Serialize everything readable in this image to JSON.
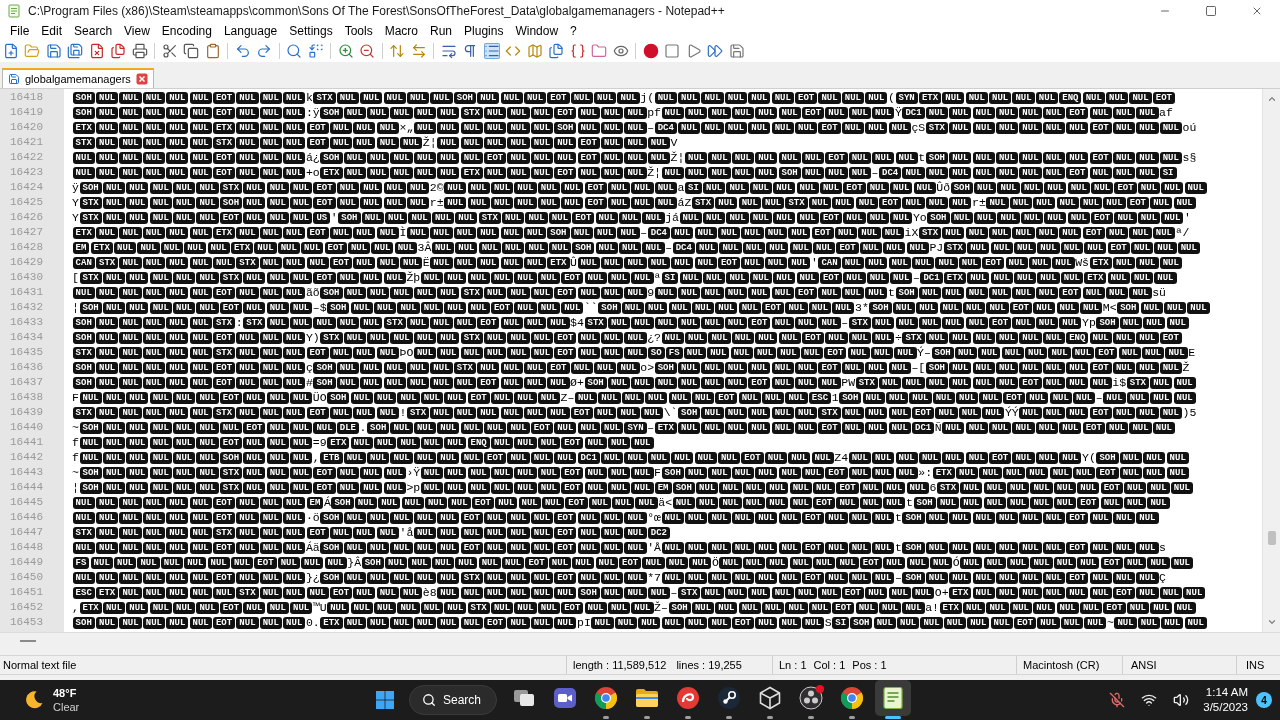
{
  "window": {
    "title": "C:\\Program Files (x86)\\Steam\\steamapps\\common\\Sons Of The Forest\\SonsOfTheForest_Data\\globalgamemanagers - Notepad++"
  },
  "menu": [
    "File",
    "Edit",
    "Search",
    "View",
    "Encoding",
    "Language",
    "Settings",
    "Tools",
    "Macro",
    "Run",
    "Plugins",
    "Window",
    "?"
  ],
  "toolbar": [
    [
      {
        "kind": "new",
        "pressed": false
      },
      {
        "kind": "open",
        "pressed": false
      },
      {
        "kind": "save",
        "pressed": false
      },
      {
        "kind": "save-all",
        "pressed": false
      },
      {
        "kind": "close",
        "pressed": false
      },
      {
        "kind": "close-all",
        "pressed": false
      },
      {
        "kind": "print",
        "pressed": false
      }
    ],
    [
      {
        "kind": "cut",
        "pressed": false
      },
      {
        "kind": "copy",
        "pressed": false
      },
      {
        "kind": "paste",
        "pressed": false
      }
    ],
    [
      {
        "kind": "undo",
        "pressed": false
      },
      {
        "kind": "redo",
        "pressed": false
      }
    ],
    [
      {
        "kind": "find",
        "pressed": false
      },
      {
        "kind": "replace",
        "pressed": false
      }
    ],
    [
      {
        "kind": "zoom-in",
        "pressed": false
      },
      {
        "kind": "zoom-out",
        "pressed": false
      }
    ],
    [
      {
        "kind": "sync-vertical",
        "pressed": false
      },
      {
        "kind": "sync-horizontal",
        "pressed": false
      }
    ],
    [
      {
        "kind": "wrap",
        "pressed": false
      },
      {
        "kind": "all-chars",
        "pressed": false
      },
      {
        "kind": "indent-guide",
        "pressed": true
      },
      {
        "kind": "user-language",
        "pressed": false
      },
      {
        "kind": "doc-map",
        "pressed": false
      },
      {
        "kind": "doc-list",
        "pressed": false
      },
      {
        "kind": "function-list",
        "pressed": false
      },
      {
        "kind": "folder-workspace",
        "pressed": false
      },
      {
        "kind": "monitor",
        "pressed": false
      }
    ],
    [
      {
        "kind": "record",
        "pressed": false
      },
      {
        "kind": "stop",
        "pressed": false
      },
      {
        "kind": "play",
        "pressed": false
      },
      {
        "kind": "play-multiple",
        "pressed": false
      },
      {
        "kind": "save-macro",
        "pressed": false
      }
    ]
  ],
  "tabs": [
    {
      "label": "globalgamemanagers",
      "selected": true
    }
  ],
  "editor": {
    "lines": [
      {
        "number": "16418",
        "tokens": [
          "SOH",
          "NUL",
          "NUL",
          "NUL",
          "NUL",
          "NUL",
          "EOT",
          "NUL",
          "NUL",
          "NUL",
          "k",
          "STX",
          "NUL",
          "NUL",
          "NUL",
          "NUL",
          "NUL",
          "SOH",
          "NUL",
          "NUL",
          "NUL",
          "EOT",
          "NUL",
          "NUL",
          "NUL",
          "j",
          "(",
          "NUL",
          "NUL",
          "NUL",
          "NUL",
          "NUL",
          "NUL",
          "EOT",
          "NUL",
          "NUL",
          "NUL",
          "(",
          "SYN",
          "ETX",
          "NUL",
          "NUL",
          "NUL",
          "NUL",
          "NUL",
          "ENQ",
          "NUL",
          "NUL",
          "NUL",
          "EOT"
        ]
      },
      {
        "number": "16419",
        "tokens": [
          "SOH",
          "NUL",
          "NUL",
          "NUL",
          "NUL",
          "NUL",
          "EOT",
          "NUL",
          "NUL",
          "NUL",
          ":",
          "ÿ",
          "SOH",
          "NUL",
          "NUL",
          "NUL",
          "NUL",
          "NUL",
          "STX",
          "NUL",
          "NUL",
          "NUL",
          "EOT",
          "NUL",
          "NUL",
          "NUL",
          "p",
          "f",
          "NUL",
          "NUL",
          "NUL",
          "NUL",
          "NUL",
          "NUL",
          "EOT",
          "NUL",
          "NUL",
          "NUL",
          "Ÿ",
          "DC1",
          "NUL",
          "NUL",
          "NUL",
          "NUL",
          "NUL",
          "NUL",
          "EOT",
          "NUL",
          "NUL",
          "NUL",
          "a",
          "f"
        ]
      },
      {
        "number": "16420",
        "tokens": [
          "ETX",
          "NUL",
          "NUL",
          "NUL",
          "NUL",
          "NUL",
          "ETX",
          "NUL",
          "NUL",
          "NUL",
          "EOT",
          "NUL",
          "NUL",
          "NUL",
          "×",
          "„",
          "NUL",
          "NUL",
          "NUL",
          "NUL",
          "NUL",
          "NUL",
          "SOH",
          "NUL",
          "NUL",
          "NUL",
          "–",
          "DC4",
          "NUL",
          "NUL",
          "NUL",
          "NUL",
          "NUL",
          "NUL",
          "EOT",
          "NUL",
          "NUL",
          "NUL",
          "ç",
          "S",
          "STX",
          "NUL",
          "NUL",
          "NUL",
          "NUL",
          "NUL",
          "NUL",
          "EOT",
          "NUL",
          "NUL",
          "NUL",
          "o",
          "ú"
        ]
      },
      {
        "number": "16421",
        "tokens": [
          "STX",
          "NUL",
          "NUL",
          "NUL",
          "NUL",
          "NUL",
          "STX",
          "NUL",
          "NUL",
          "NUL",
          "EOT",
          "NUL",
          "NUL",
          "NUL",
          "NUL",
          "Ž",
          "¦",
          "NUL",
          "NUL",
          "NUL",
          "NUL",
          "NUL",
          "NUL",
          "EOT",
          "NUL",
          "NUL",
          "NUL",
          "V"
        ]
      },
      {
        "number": "16422",
        "tokens": [
          "NUL",
          "NUL",
          "NUL",
          "NUL",
          "NUL",
          "NUL",
          "EOT",
          "NUL",
          "NUL",
          "NUL",
          "á",
          "¿",
          "SOH",
          "NUL",
          "NUL",
          "NUL",
          "NUL",
          "NUL",
          "NUL",
          "EOT",
          "NUL",
          "NUL",
          "NUL",
          "EOT",
          "NUL",
          "NUL",
          "NUL",
          "Ž",
          "¦",
          "NUL",
          "NUL",
          "NUL",
          "NUL",
          "NUL",
          "NUL",
          "EOT",
          "NUL",
          "NUL",
          "NUL",
          "t",
          "SOH",
          "NUL",
          "NUL",
          "NUL",
          "NUL",
          "NUL",
          "NUL",
          "EOT",
          "NUL",
          "NUL",
          "NUL",
          "s",
          "§"
        ]
      },
      {
        "number": "16423",
        "tokens": [
          "NUL",
          "NUL",
          "NUL",
          "NUL",
          "NUL",
          "NUL",
          "EOT",
          "NUL",
          "NUL",
          "NUL",
          "+",
          "o",
          "ETX",
          "NUL",
          "NUL",
          "NUL",
          "NUL",
          "NUL",
          "ETX",
          "NUL",
          "NUL",
          "NUL",
          "EOT",
          "NUL",
          "NUL",
          "NUL",
          "Ž",
          "¦",
          "NUL",
          "NUL",
          "NUL",
          "NUL",
          "NUL",
          "SOH",
          "NUL",
          "NUL",
          "NUL",
          "–",
          "DC4",
          "NUL",
          "NUL",
          "NUL",
          "NUL",
          "NUL",
          "NUL",
          "NUL",
          "EOT",
          "NUL",
          "NUL",
          "NUL",
          "SI"
        ]
      },
      {
        "number": "16424",
        "tokens": [
          "ÿ",
          "SOH",
          "NUL",
          "NUL",
          "NUL",
          "NUL",
          "NUL",
          "STX",
          "NUL",
          "NUL",
          "NUL",
          "EOT",
          "NUL",
          "NUL",
          "NUL",
          "NUL",
          "2",
          "©",
          "NUL",
          "NUL",
          "NUL",
          "NUL",
          "NUL",
          "NUL",
          "EOT",
          "NUL",
          "NUL",
          "NUL",
          "a",
          "SI",
          "NUL",
          "NUL",
          "NUL",
          "NUL",
          "NUL",
          "NUL",
          "EOT",
          "NUL",
          "NUL",
          "NUL",
          "Û",
          "ð",
          "SOH",
          "NUL",
          "NUL",
          "NUL",
          "NUL",
          "NUL",
          "NUL",
          "EOT",
          "NUL",
          "NUL",
          "NUL"
        ]
      },
      {
        "number": "16425",
        "tokens": [
          "Y",
          "STX",
          "NUL",
          "NUL",
          "NUL",
          "NUL",
          "NUL",
          "SOH",
          "NUL",
          "NUL",
          "NUL",
          "EOT",
          "NUL",
          "NUL",
          "NUL",
          "NUL",
          "r",
          "±",
          "NUL",
          "NUL",
          "NUL",
          "NUL",
          "NUL",
          "NUL",
          "EOT",
          "NUL",
          "NUL",
          "NUL",
          "á",
          "Z",
          "STX",
          "NUL",
          "NUL",
          "NUL",
          "STX",
          "NUL",
          "NUL",
          "NUL",
          "EOT",
          "NUL",
          "NUL",
          "NUL",
          "r",
          "±",
          "NUL",
          "NUL",
          "NUL",
          "NUL",
          "NUL",
          "NUL",
          "EOT",
          "NUL",
          "NUL"
        ]
      },
      {
        "number": "16426",
        "tokens": [
          "Y",
          "STX",
          "NUL",
          "NUL",
          "NUL",
          "NUL",
          "NUL",
          "EOT",
          "NUL",
          "NUL",
          "NUL",
          "US",
          "'",
          "SOH",
          "NUL",
          "NUL",
          "NUL",
          "NUL",
          "NUL",
          "STX",
          "NUL",
          "NUL",
          "NUL",
          "EOT",
          "NUL",
          "NUL",
          "NUL",
          "j",
          "á",
          "NUL",
          "NUL",
          "NUL",
          "NUL",
          "NUL",
          "NUL",
          "EOT",
          "NUL",
          "NUL",
          "NUL",
          "Y",
          "o",
          "SOH",
          "NUL",
          "NUL",
          "NUL",
          "NUL",
          "NUL",
          "NUL",
          "EOT",
          "NUL",
          "NUL",
          "NUL",
          "'"
        ]
      },
      {
        "number": "16427",
        "tokens": [
          "ETX",
          "NUL",
          "NUL",
          "NUL",
          "NUL",
          "NUL",
          "ETX",
          "NUL",
          "NUL",
          "NUL",
          "EOT",
          "NUL",
          "NUL",
          "NUL",
          "Ì",
          "NUL",
          "NUL",
          "NUL",
          "NUL",
          "NUL",
          "NUL",
          "SOH",
          "NUL",
          "NUL",
          "NUL",
          "–",
          "DC4",
          "NUL",
          "NUL",
          "NUL",
          "NUL",
          "NUL",
          "NUL",
          "EOT",
          "NUL",
          "NUL",
          "NUL",
          "i",
          "X",
          "STX",
          "NUL",
          "NUL",
          "NUL",
          "NUL",
          "NUL",
          "NUL",
          "EOT",
          "NUL",
          "NUL",
          "NUL",
          "ª",
          "/"
        ]
      },
      {
        "number": "16428",
        "tokens": [
          "EM",
          "ETX",
          "NUL",
          "NUL",
          "NUL",
          "NUL",
          "NUL",
          "ETX",
          "NUL",
          "NUL",
          "NUL",
          "EOT",
          "NUL",
          "NUL",
          "NUL",
          "3",
          "Â",
          "NUL",
          "NUL",
          "NUL",
          "NUL",
          "NUL",
          "NUL",
          "SOH",
          "NUL",
          "NUL",
          "NUL",
          "–",
          "DC4",
          "NUL",
          "NUL",
          "NUL",
          "NUL",
          "NUL",
          "NUL",
          "EOT",
          "NUL",
          "NUL",
          "NUL",
          "P",
          "J",
          "STX",
          "NUL",
          "NUL",
          "NUL",
          "NUL",
          "NUL",
          "NUL",
          "EOT",
          "NUL",
          "NUL",
          "NUL"
        ]
      },
      {
        "number": "16429",
        "tokens": [
          "CAN",
          "STX",
          "NUL",
          "NUL",
          "NUL",
          "NUL",
          "NUL",
          "STX",
          "NUL",
          "NUL",
          "NUL",
          "EOT",
          "NUL",
          "NUL",
          "NUL",
          "Ë",
          "NUL",
          "NUL",
          "NUL",
          "NUL",
          "NUL",
          "ETX",
          "Û",
          "NUL",
          "NUL",
          "NUL",
          "NUL",
          "NUL",
          "NUL",
          "EOT",
          "NUL",
          "NUL",
          "NUL",
          "'",
          "CAN",
          "NUL",
          "NUL",
          "NUL",
          "NUL",
          "NUL",
          "NUL",
          "EOT",
          "NUL",
          "NUL",
          "NUL",
          "W",
          "š",
          "ETX",
          "NUL",
          "NUL",
          "NUL"
        ]
      },
      {
        "number": "16430",
        "tokens": [
          "[",
          "STX",
          "NUL",
          "NUL",
          "NUL",
          "NUL",
          "NUL",
          "STX",
          "NUL",
          "NUL",
          "NUL",
          "EOT",
          "NUL",
          "NUL",
          "NUL",
          "Ž",
          "þ",
          "NUL",
          "NUL",
          "NUL",
          "NUL",
          "NUL",
          "NUL",
          "EOT",
          "NUL",
          "NUL",
          "NUL",
          "ª",
          "SI",
          "NUL",
          "NUL",
          "NUL",
          "NUL",
          "NUL",
          "NUL",
          "EOT",
          "NUL",
          "NUL",
          "NUL",
          "–",
          "DC1",
          "ETX",
          "NUL",
          "NUL",
          "NUL",
          "NUL",
          "NUL",
          "ETX",
          "NUL",
          "NUL",
          "NUL"
        ]
      },
      {
        "number": "16431",
        "tokens": [
          "NUL",
          "NUL",
          "NUL",
          "NUL",
          "NUL",
          "NUL",
          "EOT",
          "NUL",
          "NUL",
          "NUL",
          "ã",
          "õ",
          "SOH",
          "NUL",
          "NUL",
          "NUL",
          "NUL",
          "NUL",
          "STX",
          "NUL",
          "NUL",
          "NUL",
          "EOT",
          "NUL",
          "NUL",
          "NUL",
          "9",
          "NUL",
          "NUL",
          "NUL",
          "NUL",
          "NUL",
          "NUL",
          "EOT",
          "NUL",
          "NUL",
          "NUL",
          "t",
          "SOH",
          "NUL",
          "NUL",
          "NUL",
          "NUL",
          "NUL",
          "NUL",
          "EOT",
          "NUL",
          "NUL",
          "NUL",
          "s",
          "ü"
        ]
      },
      {
        "number": "16432",
        "tokens": [
          "¦",
          "SOH",
          "NUL",
          "NUL",
          "NUL",
          "NUL",
          "NUL",
          "EOT",
          "NUL",
          "NUL",
          "NUL",
          "–",
          "$",
          "SOH",
          "NUL",
          "NUL",
          "NUL",
          "NUL",
          "NUL",
          "NUL",
          "EOT",
          "NUL",
          "NUL",
          "NUL",
          "`",
          "`",
          "SOH",
          "NUL",
          "NUL",
          "NUL",
          "NUL",
          "NUL",
          "NUL",
          "EOT",
          "NUL",
          "NUL",
          "NUL",
          "3",
          "*",
          "SOH",
          "NUL",
          "NUL",
          "NUL",
          "NUL",
          "NUL",
          "EOT",
          "NUL",
          "NUL",
          "NUL",
          "M",
          "<",
          "SOH",
          "NUL",
          "NUL",
          "NUL"
        ]
      },
      {
        "number": "16433",
        "tokens": [
          "SOH",
          "NUL",
          "NUL",
          "NUL",
          "NUL",
          "NUL",
          "STX",
          ":",
          "STX",
          "NUL",
          "NUL",
          "NUL",
          "NUL",
          "NUL",
          "STX",
          "NUL",
          "NUL",
          "NUL",
          "EOT",
          "NUL",
          "NUL",
          "NUL",
          "$",
          "4",
          "STX",
          "NUL",
          "NUL",
          "NUL",
          "NUL",
          "NUL",
          "NUL",
          "EOT",
          "NUL",
          "NUL",
          "NUL",
          "–",
          "STX",
          "NUL",
          "NUL",
          "NUL",
          "NUL",
          "NUL",
          "EOT",
          "NUL",
          "NUL",
          "NUL",
          "Y",
          "p",
          "SOH",
          "NUL",
          "NUL",
          "NUL"
        ]
      },
      {
        "number": "16434",
        "tokens": [
          "SOH",
          "NUL",
          "NUL",
          "NUL",
          "NUL",
          "NUL",
          "EOT",
          "NUL",
          "NUL",
          "NUL",
          "Y",
          ")",
          "STX",
          "NUL",
          "NUL",
          "NUL",
          "NUL",
          "NUL",
          "STX",
          "NUL",
          "NUL",
          "NUL",
          "EOT",
          "NUL",
          "NUL",
          "NUL",
          "¿",
          "?",
          "NUL",
          "NUL",
          "NUL",
          "NUL",
          "NUL",
          "NUL",
          "EOT",
          "NUL",
          "NUL",
          "NUL",
          "÷",
          "STX",
          "NUL",
          "NUL",
          "NUL",
          "NUL",
          "NUL",
          "NUL",
          "ENQ",
          "NUL",
          "NUL",
          "NUL",
          "EOT"
        ]
      },
      {
        "number": "16435",
        "tokens": [
          "STX",
          "NUL",
          "NUL",
          "NUL",
          "NUL",
          "NUL",
          "STX",
          "NUL",
          "NUL",
          "NUL",
          "EOT",
          "NUL",
          "NUL",
          "NUL",
          "Þ",
          "O",
          "NUL",
          "NUL",
          "NUL",
          "NUL",
          "NUL",
          "NUL",
          "EOT",
          "NUL",
          "NUL",
          "NUL",
          "SO",
          "FS",
          "NUL",
          "NUL",
          "NUL",
          "NUL",
          "NUL",
          "NUL",
          "EOT",
          "NUL",
          "NUL",
          "NUL",
          "Ý",
          "–",
          "SOH",
          "NUL",
          "NUL",
          "NUL",
          "NUL",
          "NUL",
          "NUL",
          "EOT",
          "NUL",
          "NUL",
          "NUL",
          "E"
        ]
      },
      {
        "number": "16436",
        "tokens": [
          "SOH",
          "NUL",
          "NUL",
          "NUL",
          "NUL",
          "NUL",
          "EOT",
          "NUL",
          "NUL",
          "NUL",
          "ç",
          "SOH",
          "NUL",
          "NUL",
          "NUL",
          "NUL",
          "NUL",
          "STX",
          "NUL",
          "NUL",
          "NUL",
          "EOT",
          "NUL",
          "NUL",
          "NUL",
          "o",
          ">",
          "SOH",
          "NUL",
          "NUL",
          "NUL",
          "NUL",
          "NUL",
          "NUL",
          "EOT",
          "NUL",
          "NUL",
          "NUL",
          "–",
          "[",
          "SOH",
          "NUL",
          "NUL",
          "NUL",
          "NUL",
          "NUL",
          "NUL",
          "EOT",
          "NUL",
          "NUL",
          "NUL",
          "Ž"
        ]
      },
      {
        "number": "16437",
        "tokens": [
          "SOH",
          "NUL",
          "NUL",
          "NUL",
          "NUL",
          "NUL",
          "EOT",
          "NUL",
          "NUL",
          "NUL",
          "#",
          "SOH",
          "NUL",
          "NUL",
          "NUL",
          "NUL",
          "NUL",
          "NUL",
          "EOT",
          "NUL",
          "NUL",
          "NUL",
          "Ø",
          "+",
          "SOH",
          "NUL",
          "NUL",
          "NUL",
          "NUL",
          "NUL",
          "NUL",
          "EOT",
          "NUL",
          "NUL",
          "NUL",
          "P",
          "W",
          "STX",
          "NUL",
          "NUL",
          "NUL",
          "NUL",
          "NUL",
          "NUL",
          "EOT",
          "NUL",
          "NUL",
          "NUL",
          "i",
          "$",
          "STX",
          "NUL",
          "NUL"
        ]
      },
      {
        "number": "16438",
        "tokens": [
          "F",
          "NUL",
          "NUL",
          "NUL",
          "NUL",
          "NUL",
          "NUL",
          "EOT",
          "NUL",
          "NUL",
          "NUL",
          "Ü",
          "O",
          "SOH",
          "NUL",
          "NUL",
          "NUL",
          "NUL",
          "NUL",
          "EOT",
          "NUL",
          "NUL",
          "NUL",
          "Z",
          "–",
          "NUL",
          "NUL",
          "NUL",
          "NUL",
          "NUL",
          "NUL",
          "EOT",
          "NUL",
          "NUL",
          "NUL",
          "ESC",
          "1",
          "SOH",
          "NUL",
          "NUL",
          "NUL",
          "NUL",
          "NUL",
          "NUL",
          "EOT",
          "NUL",
          "NUL",
          "NUL",
          "–",
          "NUL",
          "NUL",
          "NUL",
          "NUL"
        ]
      },
      {
        "number": "16439",
        "tokens": [
          "STX",
          "NUL",
          "NUL",
          "NUL",
          "NUL",
          "NUL",
          "STX",
          "NUL",
          "NUL",
          "NUL",
          "EOT",
          "NUL",
          "NUL",
          "NUL",
          "!",
          "STX",
          "NUL",
          "NUL",
          "NUL",
          "NUL",
          "NUL",
          "NUL",
          "EOT",
          "NUL",
          "NUL",
          "NUL",
          "\\",
          "`",
          "SOH",
          "NUL",
          "NUL",
          "NUL",
          "NUL",
          "NUL",
          "STX",
          "NUL",
          "NUL",
          "NUL",
          "EOT",
          "NUL",
          "NUL",
          "NUL",
          "Ý",
          "Ý",
          "NUL",
          "NUL",
          "NUL",
          "EOT",
          "NUL",
          "NUL",
          "NUL",
          ")",
          "5"
        ]
      },
      {
        "number": "16440",
        "tokens": [
          "~",
          "SOH",
          "NUL",
          "NUL",
          "NUL",
          "NUL",
          "NUL",
          "NUL",
          "EOT",
          "NUL",
          "NUL",
          "NUL",
          "DLE",
          ".",
          "SOH",
          "NUL",
          "NUL",
          "NUL",
          "NUL",
          "NUL",
          "NUL",
          "EOT",
          "NUL",
          "NUL",
          "NUL",
          "SYN",
          "–",
          "ETX",
          "NUL",
          "NUL",
          "NUL",
          "NUL",
          "NUL",
          "NUL",
          "EOT",
          "NUL",
          "NUL",
          "NUL",
          "DC1",
          "Ñ",
          "NUL",
          "NUL",
          "NUL",
          "NUL",
          "NUL",
          "NUL",
          "EOT",
          "NUL",
          "NUL",
          "NUL"
        ]
      },
      {
        "number": "16441",
        "tokens": [
          "f",
          "NUL",
          "NUL",
          "NUL",
          "NUL",
          "NUL",
          "NUL",
          "EOT",
          "NUL",
          "NUL",
          "NUL",
          "=",
          "9",
          "ETX",
          "NUL",
          "NUL",
          "NUL",
          "NUL",
          "NUL",
          "ENQ",
          "NUL",
          "NUL",
          "NUL",
          "EOT",
          "NUL",
          "NUL",
          "NUL"
        ]
      },
      {
        "number": "16442",
        "tokens": [
          "f",
          "NUL",
          "NUL",
          "NUL",
          "NUL",
          "NUL",
          "NUL",
          "SOH",
          "NUL",
          "NUL",
          "NUL",
          ",",
          "ETB",
          "NUL",
          "NUL",
          "NUL",
          "NUL",
          "NUL",
          "NUL",
          "EOT",
          "NUL",
          "NUL",
          "NUL",
          "DC1",
          "NUL",
          "NUL",
          "NUL",
          "NUL",
          "NUL",
          "NUL",
          "EOT",
          "NUL",
          "NUL",
          "NUL",
          "Z",
          "4",
          "NUL",
          "NUL",
          "NUL",
          "NUL",
          "NUL",
          "NUL",
          "EOT",
          "NUL",
          "NUL",
          "NUL",
          "Y",
          "(",
          "SOH",
          "NUL",
          "NUL",
          "NUL"
        ]
      },
      {
        "number": "16443",
        "tokens": [
          "~",
          "SOH",
          "NUL",
          "NUL",
          "NUL",
          "NUL",
          "NUL",
          "STX",
          "NUL",
          "NUL",
          "NUL",
          "EOT",
          "NUL",
          "NUL",
          "NUL",
          "›",
          "Ÿ",
          "NUL",
          "NUL",
          "NUL",
          "NUL",
          "NUL",
          "NUL",
          "EOT",
          "NUL",
          "NUL",
          "NUL",
          "F",
          "SOH",
          "NUL",
          "NUL",
          "NUL",
          "NUL",
          "NUL",
          "NUL",
          "EOT",
          "NUL",
          "NUL",
          "NUL",
          "»",
          ":",
          "ETX",
          "NUL",
          "NUL",
          "NUL",
          "NUL",
          "NUL",
          "NUL",
          "EOT",
          "NUL",
          "NUL",
          "NUL"
        ]
      },
      {
        "number": "16444",
        "tokens": [
          "¦",
          "SOH",
          "NUL",
          "NUL",
          "NUL",
          "NUL",
          "NUL",
          "STX",
          "NUL",
          "NUL",
          "NUL",
          "EOT",
          "NUL",
          "NUL",
          "NUL",
          ">",
          "p",
          "NUL",
          "NUL",
          "NUL",
          "NUL",
          "NUL",
          "NUL",
          "EOT",
          "NUL",
          "NUL",
          "NUL",
          "EM",
          "SOH",
          "NUL",
          "NUL",
          "NUL",
          "NUL",
          "NUL",
          "NUL",
          "EOT",
          "NUL",
          "NUL",
          "NUL",
          "6",
          "STX",
          "NUL",
          "NUL",
          "NUL",
          "NUL",
          "NUL",
          "NUL",
          "EOT",
          "NUL",
          "NUL",
          "NUL"
        ]
      },
      {
        "number": "16445",
        "tokens": [
          "NUL",
          "NUL",
          "NUL",
          "NUL",
          "NUL",
          "NUL",
          "EOT",
          "NUL",
          "NUL",
          "NUL",
          "EM",
          "Á",
          "SOH",
          "NUL",
          "NUL",
          "NUL",
          "NUL",
          "NUL",
          "EOT",
          "NUL",
          "NUL",
          "NUL",
          "EOT",
          "NUL",
          "NUL",
          "NUL",
          "ä",
          "<",
          "NUL",
          "NUL",
          "NUL",
          "NUL",
          "NUL",
          "NUL",
          "EOT",
          "NUL",
          "NUL",
          "NUL",
          "t",
          "SOH",
          "NUL",
          "NUL",
          "NUL",
          "NUL",
          "NUL",
          "NUL",
          "EOT",
          "NUL",
          "NUL",
          "NUL"
        ]
      },
      {
        "number": "16446",
        "tokens": [
          "NUL",
          "NUL",
          "NUL",
          "NUL",
          "NUL",
          "NUL",
          "EOT",
          "NUL",
          "NUL",
          "NUL",
          "·",
          "ö",
          "SOH",
          "NUL",
          "NUL",
          "NUL",
          "NUL",
          "NUL",
          "EOT",
          "NUL",
          "NUL",
          "NUL",
          "EOT",
          "NUL",
          "NUL",
          "NUL",
          "°",
          "œ",
          "NUL",
          "NUL",
          "NUL",
          "NUL",
          "NUL",
          "NUL",
          "EOT",
          "NUL",
          "NUL",
          "NUL",
          "t",
          "SOH",
          "NUL",
          "NUL",
          "NUL",
          "NUL",
          "NUL",
          "NUL",
          "EOT",
          "NUL",
          "NUL",
          "NUL"
        ]
      },
      {
        "number": "16447",
        "tokens": [
          "STX",
          "NUL",
          "NUL",
          "NUL",
          "NUL",
          "NUL",
          "STX",
          "NUL",
          "NUL",
          "NUL",
          "EOT",
          "NUL",
          "NUL",
          "NUL",
          "'",
          "å",
          "NUL",
          "NUL",
          "NUL",
          "NUL",
          "NUL",
          "NUL",
          "EOT",
          "NUL",
          "NUL",
          "NUL",
          "DC2"
        ]
      },
      {
        "number": "16448",
        "tokens": [
          "NUL",
          "NUL",
          "NUL",
          "NUL",
          "NUL",
          "NUL",
          "EOT",
          "NUL",
          "NUL",
          "NUL",
          "Á",
          "ä",
          "SOH",
          "NUL",
          "NUL",
          "NUL",
          "NUL",
          "NUL",
          "EOT",
          "NUL",
          "NUL",
          "NUL",
          "EOT",
          "NUL",
          "NUL",
          "NUL",
          "'",
          "Å",
          "NUL",
          "NUL",
          "NUL",
          "NUL",
          "NUL",
          "NUL",
          "EOT",
          "NUL",
          "NUL",
          "NUL",
          "t",
          "SOH",
          "NUL",
          "NUL",
          "NUL",
          "NUL",
          "NUL",
          "NUL",
          "EOT",
          "NUL",
          "NUL",
          "NUL",
          "s"
        ]
      },
      {
        "number": "16449",
        "tokens": [
          "FS",
          "NUL",
          "NUL",
          "NUL",
          "NUL",
          "NUL",
          "NUL",
          "NUL",
          "EOT",
          "NUL",
          "NUL",
          "NUL",
          "}",
          "Â",
          "SOH",
          "NUL",
          "NUL",
          "NUL",
          "NUL",
          "NUL",
          "NUL",
          "EOT",
          "NUL",
          "NUL",
          "NUL",
          "EOT",
          "NUL",
          "NUL",
          "NUL",
          "Ö",
          "NUL",
          "NUL",
          "NUL",
          "NUL",
          "NUL",
          "NUL",
          "EOT",
          "NUL",
          "NUL",
          "NUL",
          "Ó",
          "NUL",
          "NUL",
          "NUL",
          "NUL",
          "NUL",
          "NUL",
          "EOT",
          "NUL",
          "NUL",
          "NUL"
        ]
      },
      {
        "number": "16450",
        "tokens": [
          "NUL",
          "NUL",
          "NUL",
          "NUL",
          "NUL",
          "NUL",
          "EOT",
          "NUL",
          "NUL",
          "NUL",
          "}",
          "¿",
          "SOH",
          "NUL",
          "NUL",
          "NUL",
          "NUL",
          "NUL",
          "STX",
          "NUL",
          "NUL",
          "NUL",
          "EOT",
          "NUL",
          "NUL",
          "NUL",
          "*",
          "7",
          "NUL",
          "NUL",
          "NUL",
          "NUL",
          "NUL",
          "NUL",
          "EOT",
          "NUL",
          "NUL",
          "NUL",
          "–",
          "SOH",
          "NUL",
          "NUL",
          "NUL",
          "NUL",
          "NUL",
          "NUL",
          "EOT",
          "NUL",
          "NUL",
          "NUL",
          "Ç"
        ]
      },
      {
        "number": "16451",
        "tokens": [
          "ESC",
          "ETX",
          "NUL",
          "NUL",
          "NUL",
          "NUL",
          "NUL",
          "STX",
          "NUL",
          "NUL",
          "NUL",
          "EOT",
          "NUL",
          "NUL",
          "NUL",
          "è",
          "8",
          "NUL",
          "NUL",
          "NUL",
          "NUL",
          "NUL",
          "NUL",
          "SOH",
          "NUL",
          "NUL",
          "NUL",
          "–",
          "STX",
          "NUL",
          "NUL",
          "NUL",
          "NUL",
          "NUL",
          "NUL",
          "EOT",
          "NUL",
          "NUL",
          "NUL",
          "O",
          "+",
          "ETX",
          "NUL",
          "NUL",
          "NUL",
          "NUL",
          "NUL",
          "NUL",
          "EOT",
          "NUL",
          "NUL",
          "NUL"
        ]
      },
      {
        "number": "16452",
        "tokens": [
          ",",
          "ETX",
          "NUL",
          "NUL",
          "NUL",
          "NUL",
          "NUL",
          "EOT",
          "NUL",
          "NUL",
          "NUL",
          "™",
          "U",
          "NUL",
          "NUL",
          "NUL",
          "NUL",
          "NUL",
          "NUL",
          "STX",
          "NUL",
          "NUL",
          "NUL",
          "EOT",
          "NUL",
          "NUL",
          "NUL",
          "Ž",
          "–",
          "SOH",
          "NUL",
          "NUL",
          "NUL",
          "NUL",
          "NUL",
          "NUL",
          "EOT",
          "NUL",
          "NUL",
          "NUL",
          "a",
          "!",
          "ETX",
          "NUL",
          "NUL",
          "NUL",
          "NUL",
          "NUL",
          "NUL",
          "EOT",
          "NUL",
          "NUL",
          "NUL"
        ]
      },
      {
        "number": "16453",
        "tokens": [
          "SOH",
          "NUL",
          "NUL",
          "NUL",
          "NUL",
          "NUL",
          "EOT",
          "NUL",
          "NUL",
          "NUL",
          "0",
          ".",
          "ETX",
          "NUL",
          "NUL",
          "NUL",
          "NUL",
          "NUL",
          "NUL",
          "EOT",
          "NUL",
          "NUL",
          "NUL",
          "p",
          "I",
          "NUL",
          "NUL",
          "NUL",
          "NUL",
          "NUL",
          "NUL",
          "EOT",
          "NUL",
          "NUL",
          "NUL",
          "S",
          "SI",
          "SOH",
          "NUL",
          "NUL",
          "NUL",
          "NUL",
          "NUL",
          "NUL",
          "EOT",
          "NUL",
          "NUL",
          "NUL",
          "~",
          "NUL",
          "NUL",
          "NUL",
          "NUL"
        ]
      }
    ]
  },
  "status_bar": {
    "file_type": "Normal text file",
    "length": "length : 11,589,512",
    "lines": "lines : 19,255",
    "line": "Ln : 1",
    "column": "Col : 1",
    "position": "Pos : 1",
    "eol": "Macintosh (CR)",
    "encoding": "ANSI",
    "mode": "INS"
  },
  "taskbar": {
    "weather": {
      "temperature": "48°F",
      "condition": "Clear"
    },
    "search": "Search",
    "apps": [
      {
        "kind": "task-view",
        "running": false,
        "active": false,
        "alert": false
      },
      {
        "kind": "video-chat",
        "running": false,
        "active": false,
        "alert": false
      },
      {
        "kind": "browser",
        "running": true,
        "active": false,
        "alert": false
      },
      {
        "kind": "file-explorer",
        "running": true,
        "active": false,
        "alert": false
      },
      {
        "kind": "swirl-app",
        "running": true,
        "active": false,
        "alert": false
      },
      {
        "kind": "game-store",
        "running": true,
        "active": false,
        "alert": false
      },
      {
        "kind": "cube",
        "running": true,
        "active": false,
        "alert": false
      },
      {
        "kind": "recorder",
        "running": true,
        "active": false,
        "alert": true
      },
      {
        "kind": "browser",
        "running": true,
        "active": false,
        "alert": false
      },
      {
        "kind": "notepad",
        "running": true,
        "active": true,
        "alert": false
      }
    ],
    "clock": {
      "time": "1:14 AM",
      "date": "3/5/2023"
    },
    "notifications": "4"
  }
}
